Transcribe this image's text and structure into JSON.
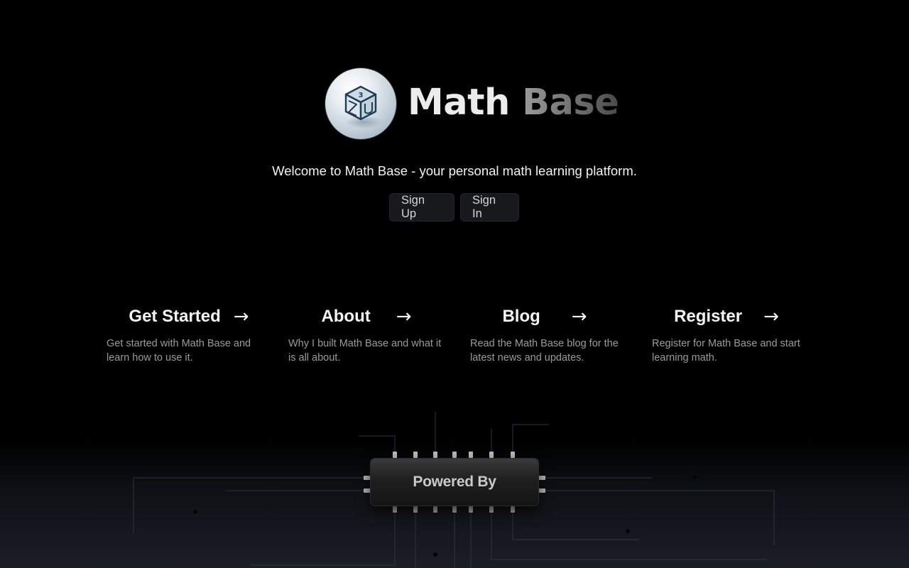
{
  "brand": {
    "word1": "Math",
    "word2": "Base",
    "logo_icon": "cube-icon",
    "logo_number": "3"
  },
  "hero": {
    "tagline": "Welcome to Math Base - your personal math learning platform.",
    "sign_up_label": "Sign Up",
    "sign_in_label": "Sign In"
  },
  "cards": [
    {
      "title": "Get Started",
      "arrow": "→",
      "description": "Get started with Math Base and learn how to use it."
    },
    {
      "title": "About",
      "arrow": "→",
      "description": "Why I built Math Base and what it is all about."
    },
    {
      "title": "Blog",
      "arrow": "→",
      "description": "Read the Math Base blog for the latest news and updates."
    },
    {
      "title": "Register",
      "arrow": "→",
      "description": "Register for Math Base and start learning math."
    }
  ],
  "footer": {
    "powered_by_label": "Powered By"
  }
}
